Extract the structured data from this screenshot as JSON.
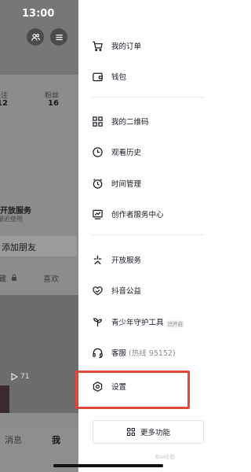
{
  "status_bar": {
    "time": "13:00"
  },
  "background_profile": {
    "stats": [
      {
        "label": "关注",
        "value": "12"
      },
      {
        "label": "粉丝",
        "value": "16"
      }
    ],
    "service_title": "开放服务",
    "service_subtitle": "最近使用",
    "add_friend_label": "添加朋友",
    "tabs": [
      "藏",
      "喜欢"
    ],
    "video_play_count": "71",
    "bottom_nav": [
      {
        "label": "消息",
        "active": false
      },
      {
        "label": "我",
        "active": true
      }
    ]
  },
  "drawer": {
    "items": [
      {
        "icon": "cart-icon",
        "label": "我的订单"
      },
      {
        "icon": "wallet-icon",
        "label": "钱包"
      },
      {
        "icon": "qrcode-icon",
        "label": "我的二维码"
      },
      {
        "icon": "clock-icon",
        "label": "观看历史"
      },
      {
        "icon": "alarm-clock-icon",
        "label": "时间管理"
      },
      {
        "icon": "creator-chart-icon",
        "label": "创作者服务中心"
      },
      {
        "icon": "asterisk-icon",
        "label": "开放服务"
      },
      {
        "icon": "heart-hands-icon",
        "label": "抖音公益"
      },
      {
        "icon": "sprout-icon",
        "label": "青少年守护工具",
        "badge": "已开启"
      },
      {
        "icon": "headset-icon",
        "label": "客服",
        "suffix": "(热线 95152)"
      },
      {
        "icon": "settings-hexagon-icon",
        "label": "设置"
      }
    ],
    "more_button_label": "更多功能",
    "highlight_color": "#e0483b"
  },
  "watermark": "Bai经验"
}
